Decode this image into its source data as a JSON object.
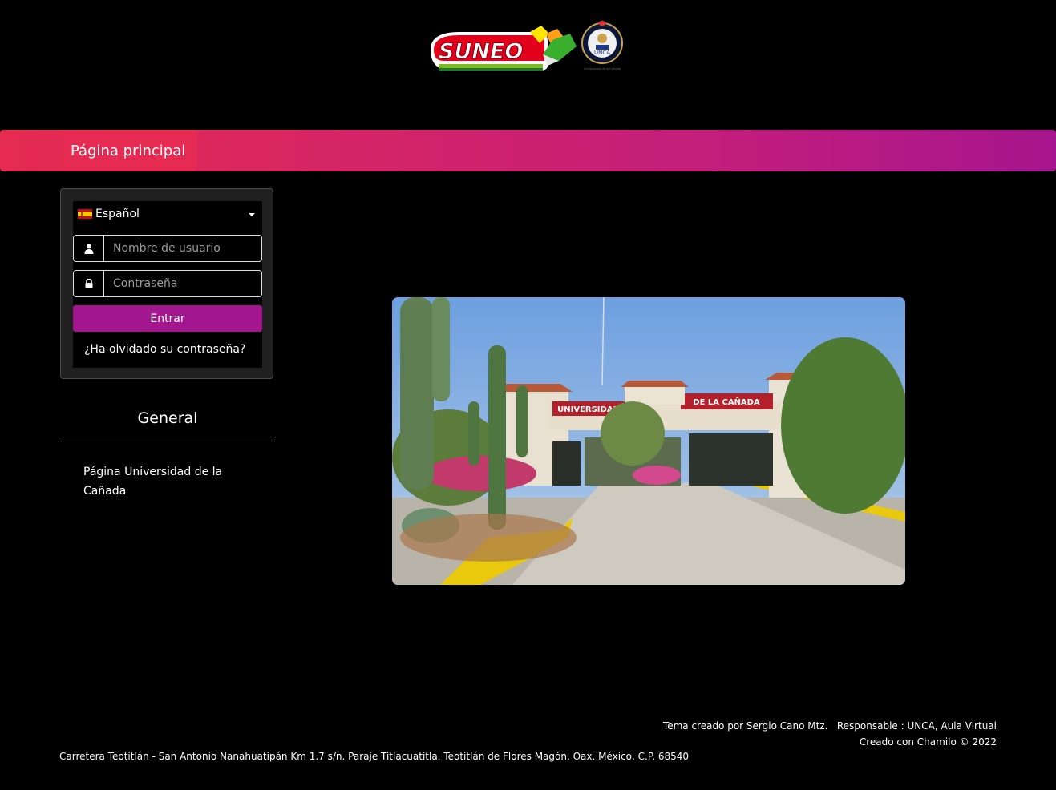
{
  "header": {
    "logo_text": "SUNEO",
    "seal_text": "UNCA",
    "seal_subtitle": "Universidad de la Cañada"
  },
  "nav": {
    "main_tab_label": "Página principal"
  },
  "login": {
    "language": {
      "selected": "Español",
      "flag_icon": "spain-flag-icon"
    },
    "username": {
      "placeholder": "Nombre de usuario",
      "value": "",
      "icon": "user-icon"
    },
    "password": {
      "placeholder": "Contraseña",
      "value": "",
      "icon": "lock-icon"
    },
    "submit_label": "Entrar",
    "forgot_label": "¿Ha olvidado su contraseña?"
  },
  "general": {
    "title": "General",
    "link_label": "Página Universidad de la Cañada"
  },
  "photo": {
    "sign_left": "UNIVERSIDAD",
    "sign_right": "DE LA CAÑADA"
  },
  "footer": {
    "theme_credit": "Tema creado por Sergio Cano Mtz.",
    "responsible": "Responsable : UNCA, Aula Virtual",
    "powered_by": "Creado con Chamilo © 2022",
    "address": "Carretera Teotitlán - San Antonio Nanahuatipán Km 1.7 s/n. Paraje Titlacuatitla. Teotitlán de Flores Magón, Oax. México, C.P. 68540"
  },
  "colors": {
    "banner_start": "#e52b50",
    "banner_end": "#a7158e",
    "button": "#a3178e",
    "background": "#000000"
  }
}
